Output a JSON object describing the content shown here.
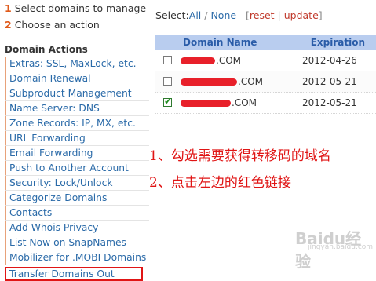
{
  "steps": [
    {
      "num": "1",
      "text": "Select domains to manage"
    },
    {
      "num": "2",
      "text": "Choose an action"
    }
  ],
  "sidebar": {
    "title": "Domain Actions",
    "items": [
      "Extras: SSL, MaxLock, etc.",
      "Domain Renewal",
      "Subproduct Management",
      "Name Server: DNS",
      "Zone Records: IP, MX, etc.",
      "URL Forwarding",
      "Email Forwarding",
      "Push to Another Account",
      "Security: Lock/Unlock",
      "Categorize Domains",
      "Contacts",
      "Add Whois Privacy",
      "List Now on SnapNames",
      "Mobilizer for .MOBI Domains",
      "Transfer Domains Out"
    ]
  },
  "select_bar": {
    "label": "Select:",
    "all": "All",
    "slash": " / ",
    "none": "None",
    "open": "[",
    "reset": "reset",
    "pipe": " | ",
    "update": "update",
    "close": "]"
  },
  "table": {
    "col_name": "Domain Name",
    "col_exp": "Expiration",
    "rows": [
      {
        "domain": ".COM",
        "expiration": "2012-04-26",
        "checked": false
      },
      {
        "domain": ".COM",
        "expiration": "2012-05-21",
        "checked": false
      },
      {
        "domain": ".COM",
        "expiration": "2012-05-21",
        "checked": true
      }
    ]
  },
  "annotations": {
    "line1": "1、勾选需要获得转移码的域名",
    "line2": "2、点击左边的红色链接"
  },
  "watermark": {
    "text": "Baidu经验",
    "sub": "jingyan.baidu.com"
  },
  "colors": {
    "link": "#2a6aa8",
    "accent": "#e05a1a",
    "annotation": "#e01515",
    "header_bg": "#b9cdef"
  }
}
